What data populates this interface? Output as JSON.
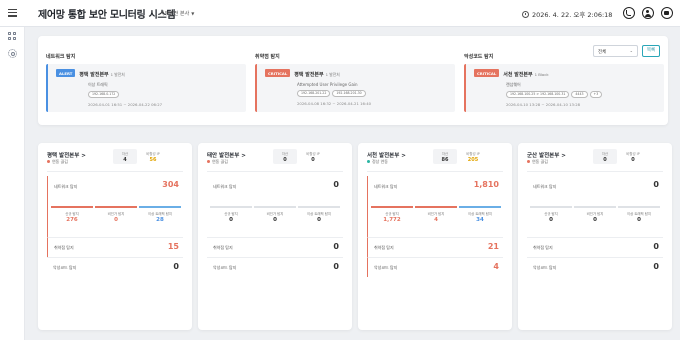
{
  "header": {
    "title": "제어망 통합 보안 모니터링 시스템",
    "site_selector": "서부발전 본사",
    "datetime": "2026. 4. 22. 오후 2:06:18"
  },
  "icons": {
    "menu": "hamburger-icon",
    "clock": "clock-icon",
    "phone": "phone-icon",
    "user": "user-icon",
    "message": "message-icon",
    "dashboard": "dashboard-icon",
    "settings": "gear-icon"
  },
  "alerts": {
    "filter_value": "전체",
    "search_label": "목록",
    "columns": [
      {
        "title": "네트워크 탐지",
        "level": "ALERT",
        "site": "평택 발전본부",
        "unit": "1 발전처",
        "desc": "이상 트래픽",
        "tags": [
          "192.168.0.172"
        ],
        "time": "2026-04-01 16:51 ~ 2026-04-22 06:27"
      },
      {
        "title": "취약점 탐지",
        "level": "CRITICAL",
        "site": "평택 발전본부",
        "unit": "1 발전처",
        "desc": "Attempted User Privilege Gain",
        "tags": [
          "192.168.201.22",
          "192.168.201.30"
        ],
        "time": "2026-04-08 16:32 ~ 2026-04-21 16:40"
      },
      {
        "title": "악성코드 탐지",
        "level": "CRITICAL",
        "site": "서천 발전본부",
        "unit": "1 Block",
        "desc": "랜섬웨어",
        "tags": [
          "192.168.100.25 > 192.168.100.31",
          "4443",
          "+3"
        ],
        "time": "2026-04-10 13:28 ~ 2026-04-10 13:28"
      }
    ]
  },
  "sites": [
    {
      "name": "평택 발전본부 >",
      "status": "연동 끊김",
      "status_color": "#e5735f",
      "stat_a_label": "자산",
      "stat_a_value": "4",
      "stat_b_label": "비활성 IP",
      "stat_b_value": "56",
      "network_label": "네트워크 탐지",
      "network_total": "304",
      "sub1_label": "신규 탐지",
      "sub1_value": "276",
      "sub2_label": "비인가 탐지",
      "sub2_value": "0",
      "sub3_label": "이상 트래픽 탐지",
      "sub3_value": "28",
      "vuln_label": "취약점 탐지",
      "vuln_value": "15",
      "malware_label": "악성코드 탐지",
      "malware_value": "0"
    },
    {
      "name": "태안 발전본부 >",
      "status": "연동 끊김",
      "status_color": "#e5735f",
      "stat_a_label": "자산",
      "stat_a_value": "0",
      "stat_b_label": "비활성 IP",
      "stat_b_value": "0",
      "network_label": "네트워크 탐지",
      "network_total": "0",
      "sub1_label": "신규 탐지",
      "sub1_value": "0",
      "sub2_label": "비인가 탐지",
      "sub2_value": "0",
      "sub3_label": "이상 트래픽 탐지",
      "sub3_value": "0",
      "vuln_label": "취약점 탐지",
      "vuln_value": "0",
      "malware_label": "악성코드 탐지",
      "malware_value": "0"
    },
    {
      "name": "서천 발전본부 >",
      "status": "정상 연동",
      "status_color": "#2bb5a3",
      "stat_a_label": "자산",
      "stat_a_value": "86",
      "stat_b_label": "비활성 IP",
      "stat_b_value": "205",
      "network_label": "네트워크 탐지",
      "network_total": "1,810",
      "sub1_label": "신규 탐지",
      "sub1_value": "1,772",
      "sub2_label": "비인가 탐지",
      "sub2_value": "4",
      "sub3_label": "이상 트래픽 탐지",
      "sub3_value": "34",
      "vuln_label": "취약점 탐지",
      "vuln_value": "21",
      "malware_label": "악성코드 탐지",
      "malware_value": "4"
    },
    {
      "name": "군산 발전본부 >",
      "status": "연동 끊김",
      "status_color": "#e5735f",
      "stat_a_label": "자산",
      "stat_a_value": "0",
      "stat_b_label": "비활성 IP",
      "stat_b_value": "0",
      "network_label": "네트워크 탐지",
      "network_total": "0",
      "sub1_label": "신규 탐지",
      "sub1_value": "0",
      "sub2_label": "비인가 탐지",
      "sub2_value": "0",
      "sub3_label": "이상 트래픽 탐지",
      "sub3_value": "0",
      "vuln_label": "취약점 탐지",
      "vuln_value": "0",
      "malware_label": "악성코드 탐지",
      "malware_value": "0"
    }
  ]
}
